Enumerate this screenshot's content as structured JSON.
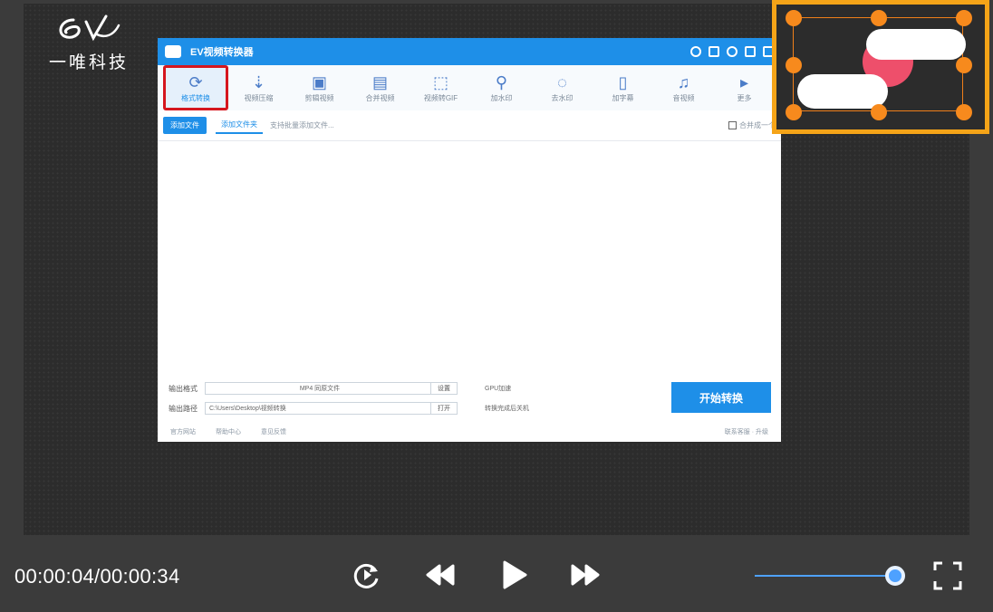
{
  "logo": {
    "mark": "ev",
    "text": "一唯科技"
  },
  "app": {
    "title": "EV视频转换器",
    "toolbar": [
      {
        "label": "格式转换",
        "icon": "convert-icon",
        "active": true
      },
      {
        "label": "视频压缩",
        "icon": "compress-icon"
      },
      {
        "label": "剪辑视频",
        "icon": "cut-icon"
      },
      {
        "label": "合并视频",
        "icon": "merge-icon"
      },
      {
        "label": "视频转GIF",
        "icon": "gif-icon"
      },
      {
        "label": "加水印",
        "icon": "watermark-icon"
      },
      {
        "label": "去水印",
        "icon": "remove-watermark-icon"
      },
      {
        "label": "加字幕",
        "icon": "subtitle-icon"
      },
      {
        "label": "音视频",
        "icon": "audio-icon"
      },
      {
        "label": "更多",
        "icon": "more-icon"
      }
    ],
    "actions": {
      "add_file": "添加文件",
      "add_folder": "添加文件夹",
      "hint": "支持批量添加文件...",
      "merge_check": "合并成一个"
    },
    "output": {
      "format_label": "输出格式",
      "format_value": "MP4 同原文件",
      "format_suffix": "设置",
      "path_label": "输出路径",
      "path_value": "C:\\Users\\Desktop\\视频转换",
      "path_suffix": "打开",
      "opt1": "GPU加速",
      "opt2": "转换完成后关机"
    },
    "start_button": "开始转换",
    "footer": {
      "links": [
        "官方网站",
        "帮助中心",
        "意见反馈"
      ],
      "right": "联系客服 · 升级"
    }
  },
  "player": {
    "time": "00:00:04/00:00:34",
    "volume": 0.93,
    "icons": [
      "replay-icon",
      "rewind-icon",
      "play-icon",
      "fast-forward-icon",
      "fullscreen-icon"
    ]
  }
}
